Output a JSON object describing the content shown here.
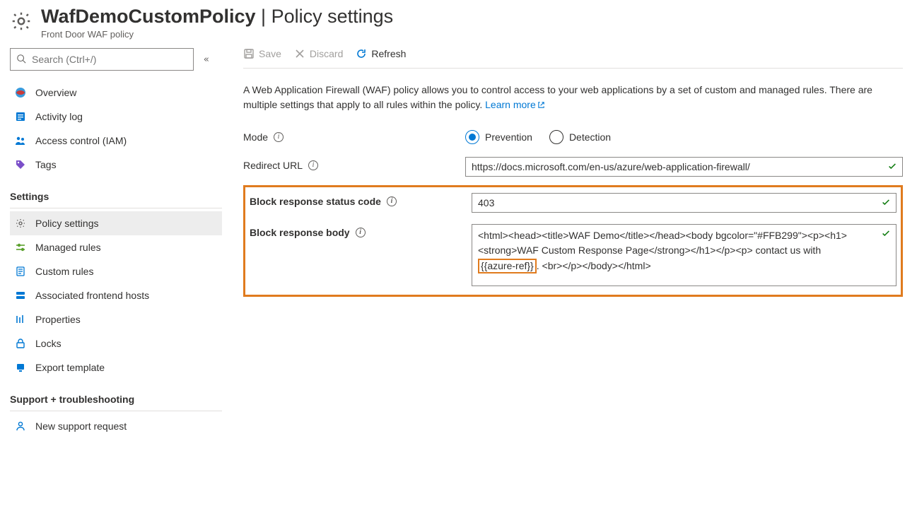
{
  "header": {
    "title_policy": "WafDemoCustomPolicy",
    "title_separator": " | ",
    "title_page": "Policy settings",
    "subtitle": "Front Door WAF policy"
  },
  "sidebar": {
    "search_placeholder": "Search (Ctrl+/)",
    "items_top": [
      {
        "label": "Overview",
        "icon": "globe"
      },
      {
        "label": "Activity log",
        "icon": "log"
      },
      {
        "label": "Access control (IAM)",
        "icon": "people"
      },
      {
        "label": "Tags",
        "icon": "tag"
      }
    ],
    "section_settings": "Settings",
    "items_settings": [
      {
        "label": "Policy settings",
        "icon": "gear",
        "selected": true
      },
      {
        "label": "Managed rules",
        "icon": "slider"
      },
      {
        "label": "Custom rules",
        "icon": "doc"
      },
      {
        "label": "Associated frontend hosts",
        "icon": "host"
      },
      {
        "label": "Properties",
        "icon": "props"
      },
      {
        "label": "Locks",
        "icon": "lock"
      },
      {
        "label": "Export template",
        "icon": "export"
      }
    ],
    "section_support": "Support + troubleshooting",
    "items_support": [
      {
        "label": "New support request",
        "icon": "support"
      }
    ]
  },
  "toolbar": {
    "save": "Save",
    "discard": "Discard",
    "refresh": "Refresh"
  },
  "intro": {
    "text": "A Web Application Firewall (WAF) policy allows you to control access to your web applications by a set of custom and managed rules. There are multiple settings that apply to all rules within the policy. ",
    "learn_more": "Learn more"
  },
  "form": {
    "mode_label": "Mode",
    "mode_options": {
      "prevention": "Prevention",
      "detection": "Detection"
    },
    "mode_value": "prevention",
    "redirect_label": "Redirect URL",
    "redirect_value": "https://docs.microsoft.com/en-us/azure/web-application-firewall/",
    "status_label": "Block response status code",
    "status_value": "403",
    "body_label": "Block response body",
    "body_value_pre": "<html><head><title>WAF Demo</title></head><body bgcolor=\"#FFB299\"><p><h1><strong>WAF Custom Response Page</strong></h1></p><p> contact us with ",
    "body_value_ref": "{{azure-ref}}",
    "body_value_post": ". <br></p></body></html>"
  }
}
